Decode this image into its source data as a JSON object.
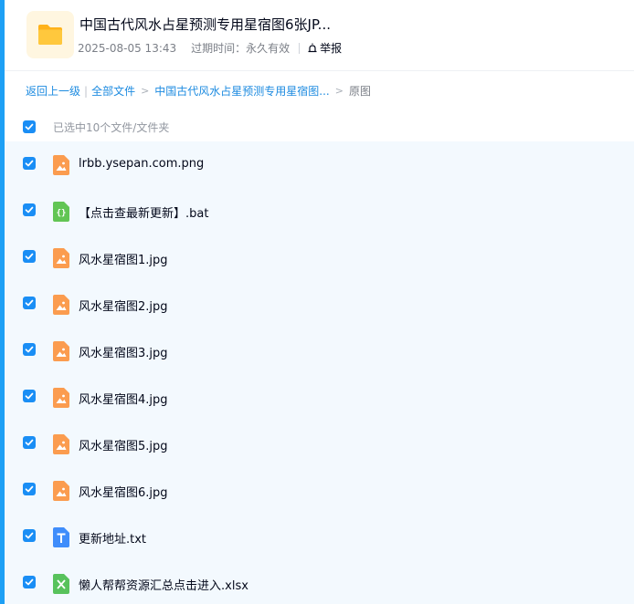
{
  "share": {
    "title": "中国古代风水占星预测专用星宿图6张JP...",
    "date": "2025-08-05 13:43",
    "expire": "过期时间：永久有效",
    "report_label": "举报"
  },
  "breadcrumb": {
    "back": "返回上一级",
    "all_files": "全部文件",
    "folder": "中国古代风水占星预测专用星宿图...",
    "current": "原图"
  },
  "selection": {
    "label": "已选中10个文件/文件夹"
  },
  "files": [
    {
      "name": "lrbb.ysepan.com.png",
      "icon": "image-file-icon"
    },
    {
      "name": "【点击查最新更新】.bat",
      "icon": "code-file-icon"
    },
    {
      "name": "风水星宿图1.jpg",
      "icon": "image-file-icon"
    },
    {
      "name": "风水星宿图2.jpg",
      "icon": "image-file-icon"
    },
    {
      "name": "风水星宿图3.jpg",
      "icon": "image-file-icon"
    },
    {
      "name": "风水星宿图4.jpg",
      "icon": "image-file-icon"
    },
    {
      "name": "风水星宿图5.jpg",
      "icon": "image-file-icon"
    },
    {
      "name": "风水星宿图6.jpg",
      "icon": "image-file-icon"
    },
    {
      "name": "更新地址.txt",
      "icon": "text-file-icon"
    },
    {
      "name": "懒人帮帮资源汇总点击进入.xlsx",
      "icon": "excel-file-icon"
    }
  ],
  "colors": {
    "accent": "#1a8ef5",
    "link": "#1d8be0",
    "image_icon": "#fb9c4f",
    "code_icon": "#62c554",
    "text_icon": "#3f8dfb",
    "excel_icon": "#58c25c",
    "folder": "#ffc435"
  }
}
